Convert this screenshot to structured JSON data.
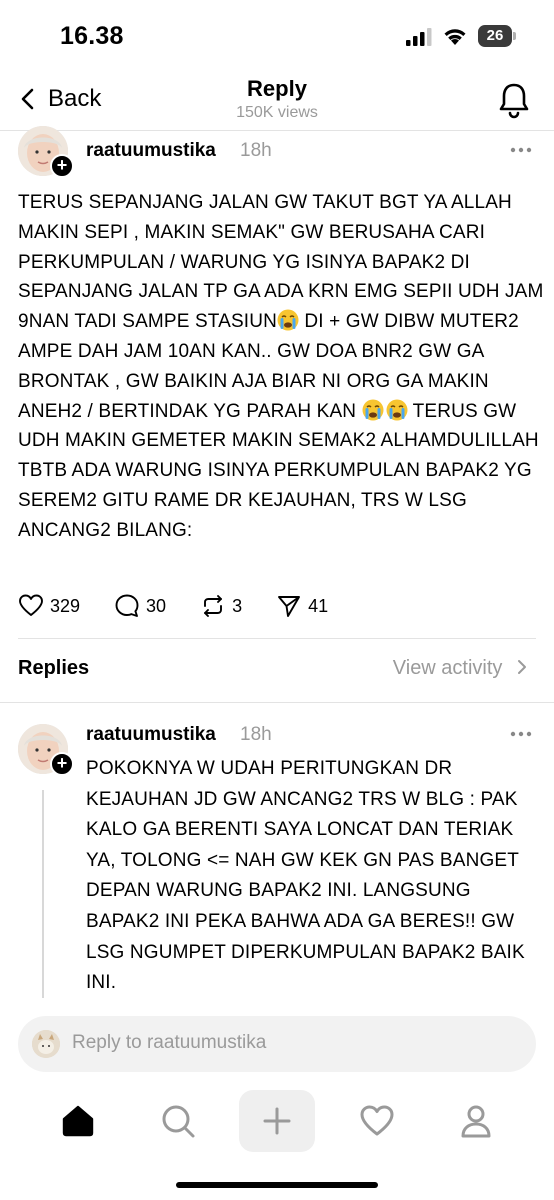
{
  "status_bar": {
    "time": "16.38",
    "battery": "26"
  },
  "nav": {
    "back_label": "Back",
    "title": "Reply",
    "subtitle": "150K views"
  },
  "post": {
    "username": "raatuumustika",
    "time": "18h",
    "text_parts": [
      "TERUS SEPANJANG JALAN GW TAKUT BGT YA ALLAH MAKIN SEPI , MAKIN SEMAK\" GW BERUSAHA CARI PERKUMPULAN / WARUNG YG ISINYA BAPAK2 DI SEPANJANG JALAN TP GA ADA KRN EMG SEPII UDH JAM 9NAN TADI SAMPE STASIUN",
      " DI + GW DIBW MUTER2 AMPE DAH JAM 10AN KAN.. GW DOA BNR2 GW GA BRONTAK , GW BAIKIN AJA BIAR NI ORG GA MAKIN ANEH2 / BERTINDAK YG PARAH KAN ",
      " TERUS GW UDH MAKIN GEMETER MAKIN SEMAK2 ALHAMDULILLAH TBTB ADA WARUNG ISINYA PERKUMPULAN BAPAK2 YG SEREM2 GITU RAME DR KEJAUHAN, TRS W LSG ANCANG2 BILANG:"
    ],
    "likes": "329",
    "comments": "30",
    "reposts": "3",
    "shares": "41"
  },
  "replies_section": {
    "title": "Replies",
    "view_activity": "View activity"
  },
  "reply": {
    "username": "raatuumustika",
    "time": "18h",
    "text": "POKOKNYA W UDAH PERITUNGKAN DR KEJAUHAN JD GW ANCANG2 TRS W BLG : PAK KALO GA BERENTI SAYA LONCAT DAN TERIAK YA, TOLONG <= NAH GW KEK GN PAS BANGET DEPAN WARUNG BAPAK2 INI. LANGSUNG BAPAK2 INI PEKA BAHWA ADA GA BERES!! GW LSG NGUMPET DIPERKUMPULAN BAPAK2 BAIK INI."
  },
  "composer": {
    "placeholder": "Reply to raatuumustika"
  },
  "icons": {
    "back": "chevron-left-icon",
    "bell": "bell-icon",
    "more": "more-horizontal-icon",
    "like": "heart-icon",
    "comment": "comment-icon",
    "repost": "repost-icon",
    "share": "send-icon",
    "home": "home-icon",
    "search": "search-icon",
    "compose": "plus-icon",
    "activity": "heart-icon",
    "profile": "profile-icon"
  },
  "colors": {
    "text": "#000000",
    "secondary": "#9a9a9a",
    "divider": "#e3e3e3",
    "input_bg": "#f2f2f2"
  }
}
